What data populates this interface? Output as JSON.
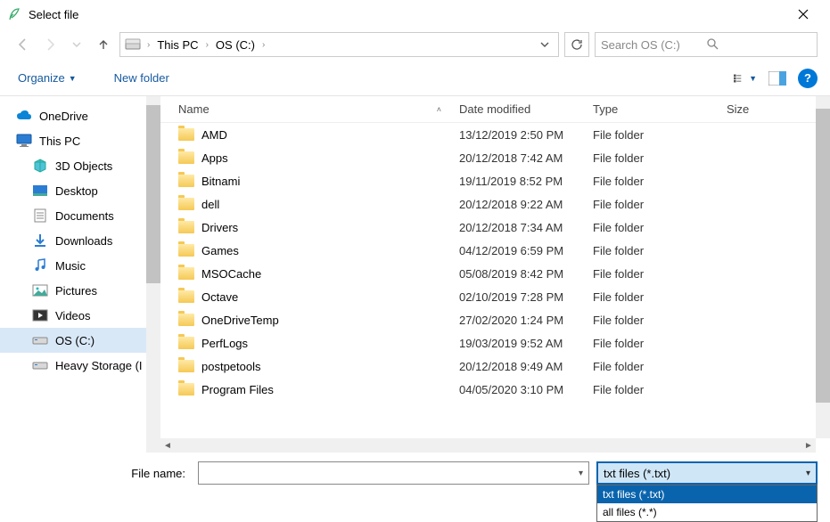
{
  "window": {
    "title": "Select file"
  },
  "nav": {
    "breadcrumb": [
      "This PC",
      "OS (C:)"
    ],
    "search_placeholder": "Search OS (C:)"
  },
  "toolbar": {
    "organize": "Organize",
    "new_folder": "New folder"
  },
  "sidebar": {
    "items": [
      {
        "label": "OneDrive",
        "icon": "cloud",
        "indent": 0
      },
      {
        "label": "This PC",
        "icon": "pc",
        "indent": 0
      },
      {
        "label": "3D Objects",
        "icon": "3d",
        "indent": 1
      },
      {
        "label": "Desktop",
        "icon": "desktop",
        "indent": 1
      },
      {
        "label": "Documents",
        "icon": "doc",
        "indent": 1
      },
      {
        "label": "Downloads",
        "icon": "download",
        "indent": 1
      },
      {
        "label": "Music",
        "icon": "music",
        "indent": 1
      },
      {
        "label": "Pictures",
        "icon": "pic",
        "indent": 1
      },
      {
        "label": "Videos",
        "icon": "video",
        "indent": 1
      },
      {
        "label": "OS (C:)",
        "icon": "drive",
        "indent": 1,
        "selected": true
      },
      {
        "label": "Heavy Storage (I",
        "icon": "drive",
        "indent": 1
      }
    ]
  },
  "columns": {
    "name": "Name",
    "date": "Date modified",
    "type": "Type",
    "size": "Size"
  },
  "files": [
    {
      "name": "AMD",
      "date": "13/12/2019 2:50 PM",
      "type": "File folder"
    },
    {
      "name": "Apps",
      "date": "20/12/2018 7:42 AM",
      "type": "File folder"
    },
    {
      "name": "Bitnami",
      "date": "19/11/2019 8:52 PM",
      "type": "File folder"
    },
    {
      "name": "dell",
      "date": "20/12/2018 9:22 AM",
      "type": "File folder"
    },
    {
      "name": "Drivers",
      "date": "20/12/2018 7:34 AM",
      "type": "File folder"
    },
    {
      "name": "Games",
      "date": "04/12/2019 6:59 PM",
      "type": "File folder"
    },
    {
      "name": "MSOCache",
      "date": "05/08/2019 8:42 PM",
      "type": "File folder"
    },
    {
      "name": "Octave",
      "date": "02/10/2019 7:28 PM",
      "type": "File folder"
    },
    {
      "name": "OneDriveTemp",
      "date": "27/02/2020 1:24 PM",
      "type": "File folder"
    },
    {
      "name": "PerfLogs",
      "date": "19/03/2019 9:52 AM",
      "type": "File folder"
    },
    {
      "name": "postpetools",
      "date": "20/12/2018 9:49 AM",
      "type": "File folder"
    },
    {
      "name": "Program Files",
      "date": "04/05/2020 3:10 PM",
      "type": "File folder"
    }
  ],
  "bottom": {
    "filename_label": "File name:",
    "filename_value": "",
    "filter_selected": "txt files (*.txt)",
    "filter_options": [
      "txt files (*.txt)",
      "all files (*.*)"
    ]
  }
}
